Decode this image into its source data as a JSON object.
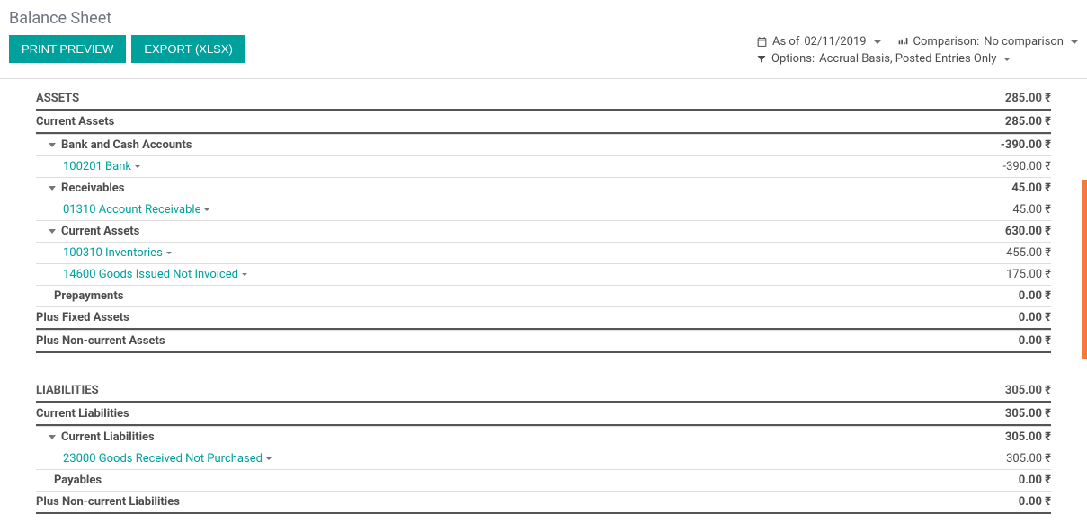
{
  "header": {
    "title": "Balance Sheet",
    "buttons": {
      "print_preview": "PRINT PREVIEW",
      "export": "EXPORT (XLSX)"
    },
    "filters": {
      "asof_prefix": "As of",
      "asof_date": "02/11/2019",
      "comparison_prefix": "Comparison:",
      "comparison_value": "No comparison",
      "options_prefix": "Options:",
      "options_value": "Accrual Basis, Posted Entries Only"
    }
  },
  "currency": "₹",
  "report": {
    "assets": {
      "label": "ASSETS",
      "value": "285.00 ₹",
      "current_assets_header": {
        "label": "Current Assets",
        "value": "285.00 ₹"
      },
      "bank_cash": {
        "label": "Bank and Cash Accounts",
        "value": "-390.00 ₹"
      },
      "bank_cash_rows": [
        {
          "label": "100201 Bank",
          "value": "-390.00 ₹"
        }
      ],
      "receivables": {
        "label": "Receivables",
        "value": "45.00 ₹"
      },
      "receivables_rows": [
        {
          "label": "01310 Account Receivable",
          "value": "45.00 ₹"
        }
      ],
      "current_assets_group": {
        "label": "Current Assets",
        "value": "630.00 ₹"
      },
      "current_assets_rows": [
        {
          "label": "100310 Inventories",
          "value": "455.00 ₹"
        },
        {
          "label": "14600 Goods Issued Not Invoiced",
          "value": "175.00 ₹"
        }
      ],
      "prepayments": {
        "label": "Prepayments",
        "value": "0.00 ₹"
      },
      "fixed_assets": {
        "label": "Plus Fixed Assets",
        "value": "0.00 ₹"
      },
      "noncurrent_assets": {
        "label": "Plus Non-current Assets",
        "value": "0.00 ₹"
      }
    },
    "liabilities": {
      "label": "LIABILITIES",
      "value": "305.00 ₹",
      "current_liab_header": {
        "label": "Current Liabilities",
        "value": "305.00 ₹"
      },
      "current_liab_group": {
        "label": "Current Liabilities",
        "value": "305.00 ₹"
      },
      "current_liab_rows": [
        {
          "label": "23000 Goods Received Not Purchased",
          "value": "305.00 ₹"
        }
      ],
      "payables": {
        "label": "Payables",
        "value": "0.00 ₹"
      },
      "noncurrent_liab": {
        "label": "Plus Non-current Liabilities",
        "value": "0.00 ₹"
      }
    }
  }
}
